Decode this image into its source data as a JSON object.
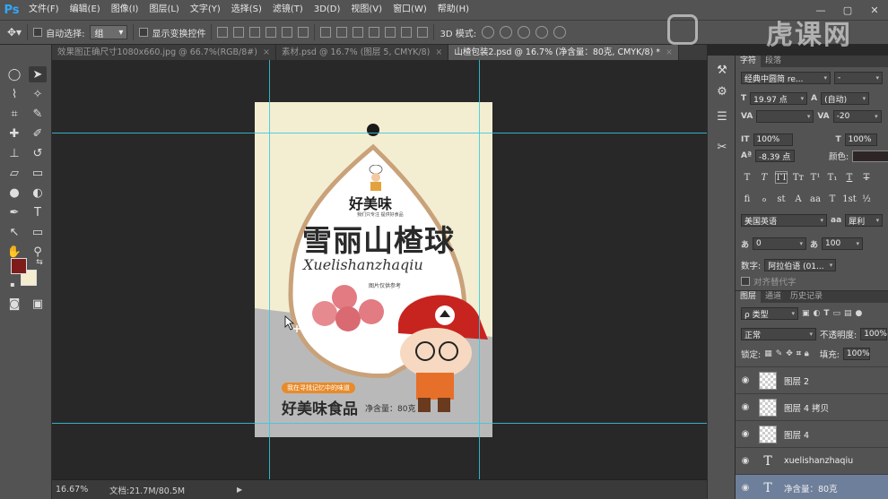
{
  "app": {
    "logo": "Ps"
  },
  "menu": [
    "文件(F)",
    "编辑(E)",
    "图像(I)",
    "图层(L)",
    "文字(Y)",
    "选择(S)",
    "滤镜(T)",
    "3D(D)",
    "视图(V)",
    "窗口(W)",
    "帮助(H)"
  ],
  "options": {
    "auto_select_label": "自动选择:",
    "auto_select_value": "组",
    "show_transform_label": "显示变换控件",
    "mode_3d_label": "3D 模式:"
  },
  "watermark": {
    "text": "虎课网"
  },
  "tabs": [
    {
      "label": "效果图正确尺寸1080x660.jpg @ 66.7%(RGB/8#)",
      "active": false
    },
    {
      "label": "素材.psd @ 16.7% (图层 5, CMYK/8)",
      "active": false
    },
    {
      "label": "山楂包装2.psd @ 16.7% (净含量：80克, CMYK/8) *",
      "active": true
    }
  ],
  "artboard": {
    "logo_text": "好美味",
    "logo_sub": "我们只专注 提供好食品",
    "title": "雪丽山楂球",
    "pinyin": "Xuelishanzhaqiu",
    "ref_note": "图片仅供参考",
    "slogan": "我在寻找记忆中的味道",
    "brand": "好美味食品",
    "net_weight": "净含量：80克",
    "colors": {
      "cream": "#f3eed2",
      "gray": "#b9b9b9",
      "accent": "#e88b2a",
      "red_cap": "#c8241f",
      "ball": "#e27b82"
    }
  },
  "status": {
    "zoom": "16.67%",
    "doc": "文档:21.7M/80.5M"
  },
  "character_panel": {
    "tabs": [
      "字符",
      "段落"
    ],
    "font_family": "经典中圆简 re...",
    "font_style": "-",
    "font_size": "19.97 点",
    "leading": "(自动)",
    "kerning": "",
    "tracking": "-20",
    "vscale": "100%",
    "hscale": "100%",
    "baseline": "-8.39 点",
    "color_label": "颜色:",
    "typo_buttons": [
      "T",
      "T",
      "TT",
      "Tт",
      "T¹",
      "T₁",
      "T",
      "T"
    ],
    "ot_buttons": [
      "fi",
      "ℴ",
      "st",
      "A",
      "aa",
      "T",
      "1st",
      "½"
    ],
    "language": "美国英语",
    "antialias": "犀利",
    "tsume": "0",
    "aki": "100",
    "digits_label": "数字:",
    "digits_value": "阿拉伯语 (01...",
    "alt_glyphs_label": "对齐替代字"
  },
  "layers_panel": {
    "tabs": [
      "图层",
      "通道",
      "历史记录"
    ],
    "filter_label": "ρ 类型",
    "blend_mode": "正常",
    "opacity_label": "不透明度:",
    "opacity": "100%",
    "lock_label": "锁定:",
    "fill_label": "填充:",
    "fill": "100%",
    "layers": [
      {
        "name": "图层 2",
        "type": "pixel",
        "selected": false
      },
      {
        "name": "图层 4 拷贝",
        "type": "pixel",
        "selected": false
      },
      {
        "name": "图层 4",
        "type": "pixel",
        "selected": false
      },
      {
        "name": "xuelishanzhaqiu",
        "type": "text",
        "selected": false
      },
      {
        "name": "净含量：80克",
        "type": "text",
        "selected": true
      }
    ]
  }
}
